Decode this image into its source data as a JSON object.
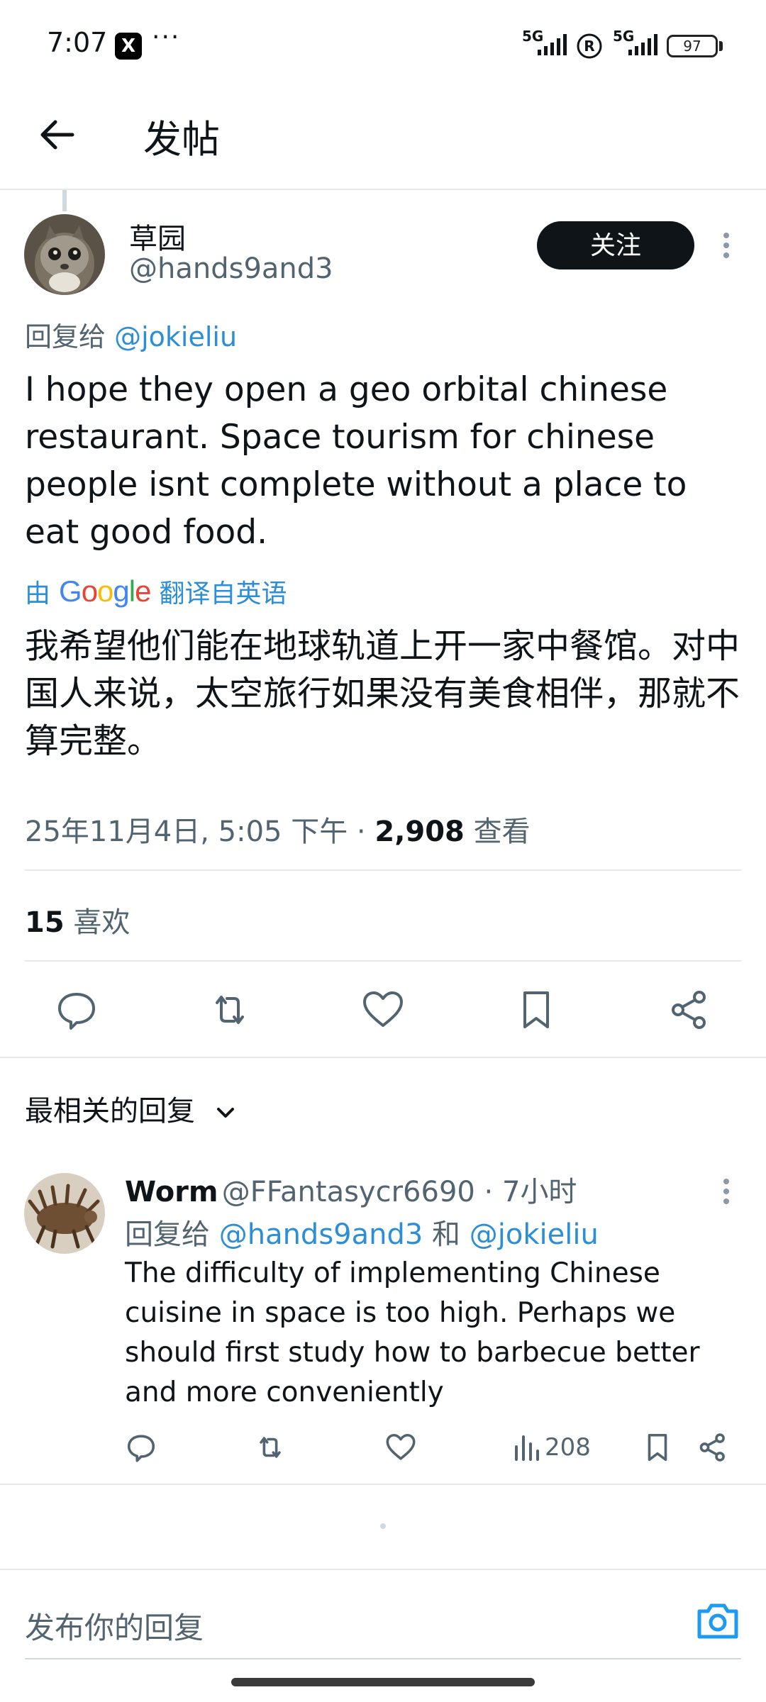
{
  "status_bar": {
    "time": "7:07",
    "app_badge": "X",
    "overflow": "···",
    "network_1": "5G",
    "network_2": "5G",
    "battery": "97"
  },
  "header": {
    "title": "发帖"
  },
  "tweet": {
    "author_name": "草园",
    "author_handle": "@hands9and3",
    "follow_label": "关注",
    "reply_prefix": "回复给",
    "reply_to": "@jokieliu",
    "body": "I hope they open a geo orbital chinese restaurant. Space tourism for chinese people isnt complete without a place to eat good food.",
    "translate_prefix": "由",
    "translate_brand": "Google",
    "translate_suffix": "翻译自英语",
    "translated_body": "我希望他们能在地球轨道上开一家中餐馆。对中国人来说，太空旅行如果没有美食相伴，那就不算完整。",
    "timestamp": "25年11月4日, 5:05 下午 · ",
    "views_count": "2,908",
    "views_label": " 查看",
    "likes_count": "15",
    "likes_label": " 喜欢"
  },
  "replies_section": {
    "sort_label": "最相关的回复"
  },
  "reply": {
    "name": "Worm",
    "handle": "@FFantasycr6690",
    "time": " · 7小时",
    "reply_prefix": "回复给 ",
    "reply_to_1": "@hands9and3",
    "reply_joiner": " 和 ",
    "reply_to_2": "@jokieliu",
    "body": "The difficulty of implementing Chinese cuisine in space is too high. Perhaps we should first study how to barbecue better and more conveniently",
    "views": "208"
  },
  "compose": {
    "placeholder": "发布你的回复"
  },
  "colors": {
    "text": "#0f1419",
    "secondary": "#536471",
    "link": "#2c8ed6",
    "divider": "#e6e9ec"
  }
}
